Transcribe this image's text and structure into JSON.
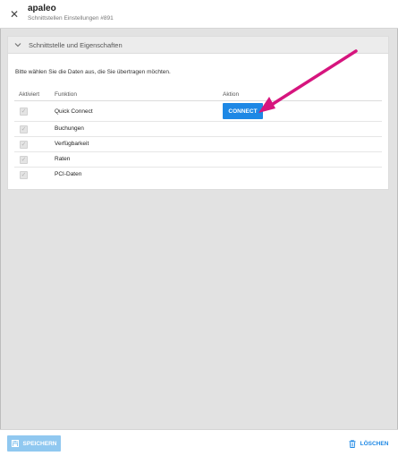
{
  "header": {
    "close_glyph": "✕",
    "title": "apaleo",
    "subtitle": "Schnittstellen Einstellungen #891"
  },
  "panel": {
    "title": "Schnittstelle und Eigenschaften",
    "hint": "Bitte wählen Sie die Daten aus, die Sie übertragen möchten.",
    "columns": [
      "Aktiviert",
      "Funktion",
      "Aktion"
    ],
    "rows": [
      {
        "function": "Quick Connect",
        "checked": true,
        "action": "CONNECT"
      },
      {
        "function": "Buchungen",
        "checked": true
      },
      {
        "function": "Verfügbarkeit",
        "checked": true
      },
      {
        "function": "Raten",
        "checked": true
      },
      {
        "function": "PCI-Daten",
        "checked": true
      }
    ],
    "checkmark": "✓"
  },
  "footer": {
    "save_label": "SPEICHERN",
    "delete_label": "LÖSCHEN"
  },
  "colors": {
    "accent": "#1e88e5",
    "accent_disabled": "#90c8f0",
    "annotation_arrow": "#d6157e",
    "background": "#e2e2e2"
  }
}
